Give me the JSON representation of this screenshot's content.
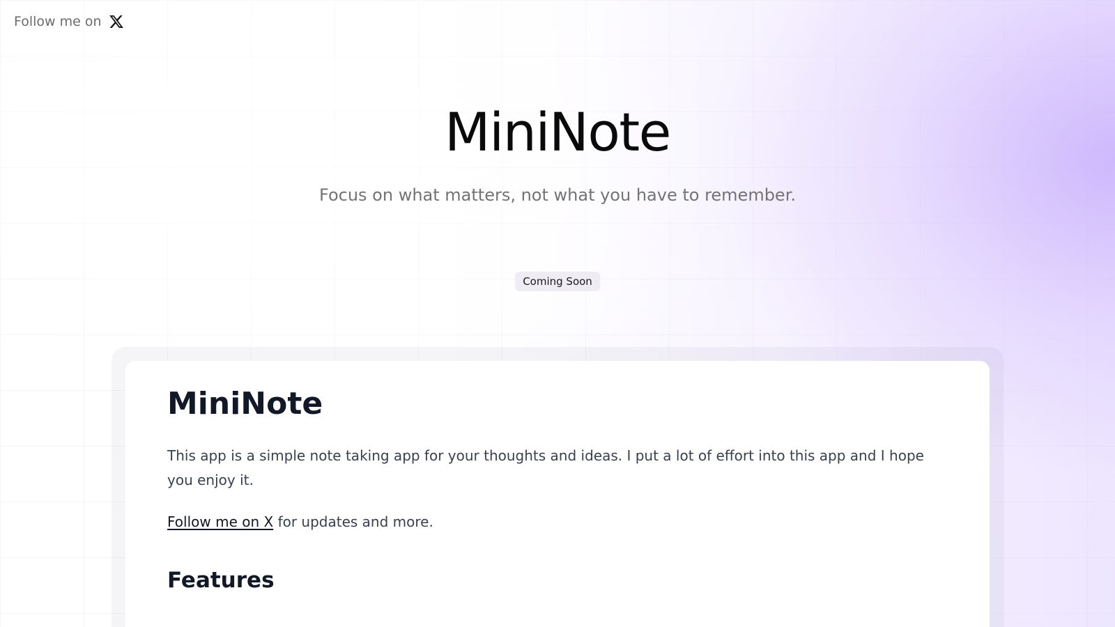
{
  "topbar": {
    "follow_label": "Follow me on",
    "icon": "x-logo-icon"
  },
  "hero": {
    "title": "MiniNote",
    "subtitle": "Focus on what matters, not what you have to remember.",
    "badge": "Coming Soon"
  },
  "card": {
    "title": "MiniNote",
    "description": "This app is a simple note taking app for your thoughts and ideas. I put a lot of effort into this app and I hope you enjoy it.",
    "follow_link": "Follow me on X",
    "follow_suffix": " for updates and more.",
    "features_heading": "Features"
  },
  "colors": {
    "accent_glow": "#c4aafc",
    "text_dark": "#111827",
    "text_muted": "#737373"
  }
}
